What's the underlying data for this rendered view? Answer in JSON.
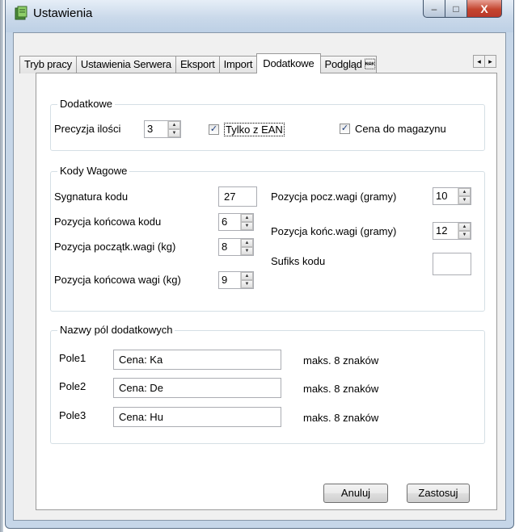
{
  "window": {
    "title": "Ustawienia",
    "minimize": "–",
    "maximize": "□",
    "close": "X"
  },
  "tabs": [
    {
      "label": "Tryb pracy"
    },
    {
      "label": "Ustawienia Serwera"
    },
    {
      "label": "Eksport"
    },
    {
      "label": "Import"
    },
    {
      "label": "Dodatkowe"
    },
    {
      "label": "Podgląd \u0015"
    }
  ],
  "tab_scroll": {
    "left": "◂",
    "right": "▸"
  },
  "dodatkowe": {
    "title": "Dodatkowe",
    "precision_label": "Precyzja ilości",
    "precision_value": "3",
    "ean_label": "Tylko z EAN",
    "ean_checked": true,
    "cena_label": "Cena do magazynu",
    "cena_checked": true
  },
  "kody": {
    "title": "Kody Wagowe",
    "sygnatura_label": "Sygnatura kodu",
    "sygnatura_value": "27",
    "koncowa_kodu_label": "Pozycja końcowa kodu",
    "koncowa_kodu_value": "6",
    "poczatk_wagi_label": "Pozycja początk.wagi (kg)",
    "poczatk_wagi_value": "8",
    "koncowa_wagi_label": "Pozycja końcowa wagi (kg)",
    "koncowa_wagi_value": "9",
    "pocz_gramy_label": "Pozycja pocz.wagi (gramy)",
    "pocz_gramy_value": "10",
    "konc_gramy_label": "Pozycja końc.wagi (gramy)",
    "konc_gramy_value": "12",
    "sufiks_label": "Sufiks kodu",
    "sufiks_value": ""
  },
  "pola": {
    "title": "Nazwy pól dodatkowych",
    "rows": [
      {
        "label": "Pole1",
        "value": "Cena: Ka",
        "hint": "maks. 8 znaków"
      },
      {
        "label": "Pole2",
        "value": "Cena: De",
        "hint": "maks. 8 znaków"
      },
      {
        "label": "Pole3",
        "value": "Cena: Hu",
        "hint": "maks. 8 znaków"
      }
    ]
  },
  "buttons": {
    "cancel": "Anuluj",
    "apply": "Zastosuj"
  },
  "spin": {
    "up": "▲",
    "down": "▼"
  },
  "check_mark": "✓",
  "colors": {
    "accent": "#1c3c7a",
    "close": "#c4452f",
    "frame": "#c6d6e8"
  }
}
